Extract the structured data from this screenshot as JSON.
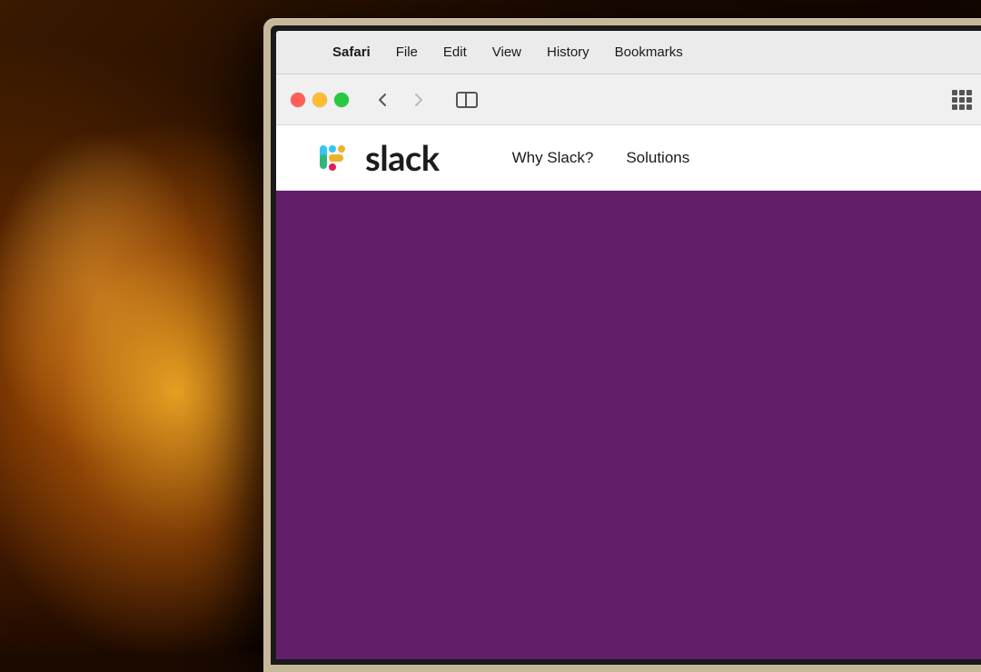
{
  "background": {
    "description": "Warm bokeh photography background with glowing filament light"
  },
  "macbook": {
    "frame_color": "#c8b89a"
  },
  "menu_bar": {
    "apple_symbol": "",
    "items": [
      {
        "label": "Safari",
        "bold": true
      },
      {
        "label": "File",
        "bold": false
      },
      {
        "label": "Edit",
        "bold": false
      },
      {
        "label": "View",
        "bold": false
      },
      {
        "label": "History",
        "bold": false
      },
      {
        "label": "Bookmarks",
        "bold": false
      }
    ]
  },
  "safari_toolbar": {
    "back_button": "‹",
    "forward_button": "›",
    "traffic_lights": [
      "red",
      "yellow",
      "green"
    ]
  },
  "slack_website": {
    "logo_text": "slack",
    "nav_links": [
      {
        "label": "Why Slack?"
      },
      {
        "label": "Solutions"
      }
    ],
    "hero_color": "#611f69"
  }
}
